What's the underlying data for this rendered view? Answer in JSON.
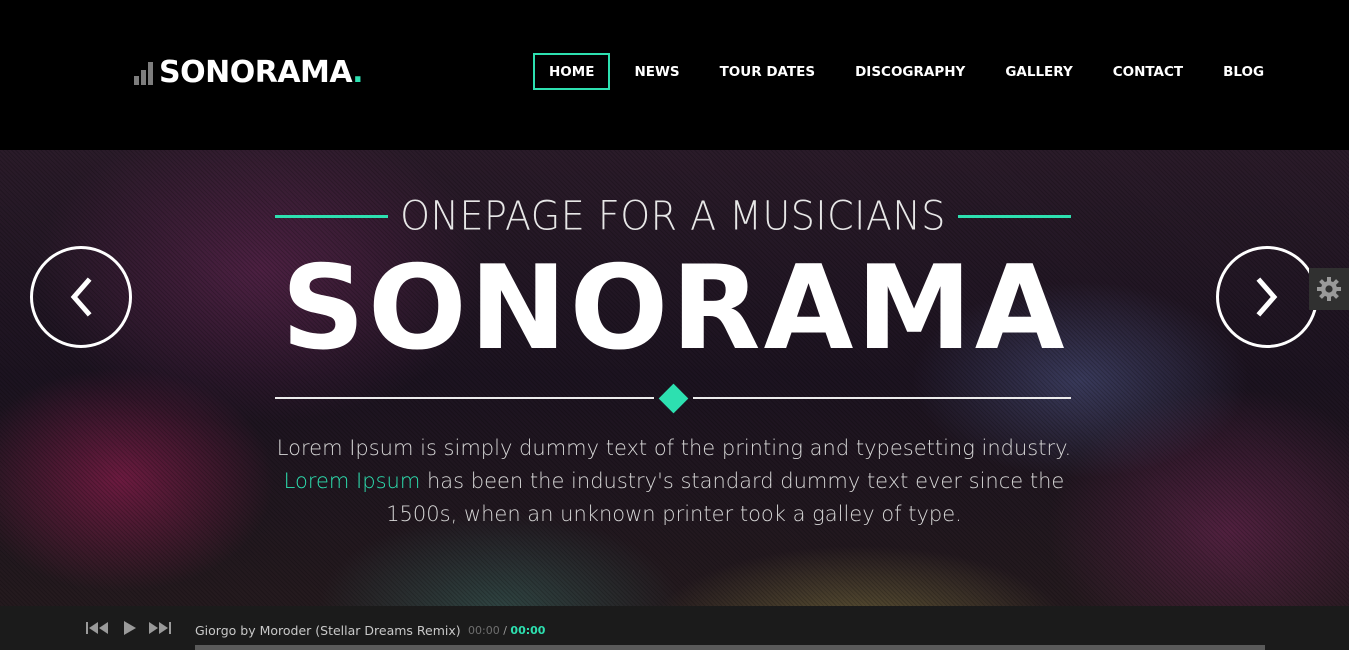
{
  "brand": {
    "name": "SONORAMA",
    "dot": ".",
    "accent_color": "#2de0b0"
  },
  "nav": {
    "items": [
      {
        "label": "HOME",
        "active": true
      },
      {
        "label": "NEWS",
        "active": false
      },
      {
        "label": "TOUR DATES",
        "active": false
      },
      {
        "label": "DISCOGRAPHY",
        "active": false
      },
      {
        "label": "GALLERY",
        "active": false
      },
      {
        "label": "CONTACT",
        "active": false
      },
      {
        "label": "BLOG",
        "active": false
      }
    ]
  },
  "hero": {
    "subtitle": "ONEPAGE FOR A MUSICIANS",
    "title": "SONORAMA",
    "text_start": "Lorem Ipsum is simply dummy text of the printing and typesetting industry.",
    "text_accent": "Lorem Ipsum",
    "text_end": " has been the industry's standard dummy text ever since the 1500s, when an unknown printer took a galley of type.",
    "prev_icon": "chevron-left-icon",
    "next_icon": "chevron-right-icon"
  },
  "settings": {
    "icon": "gear-icon"
  },
  "player": {
    "track": "Giorgo by Moroder (Stellar Dreams Remix)",
    "time_current": "00:00",
    "time_separator": "/",
    "time_duration": "00:00",
    "progress": 0
  }
}
